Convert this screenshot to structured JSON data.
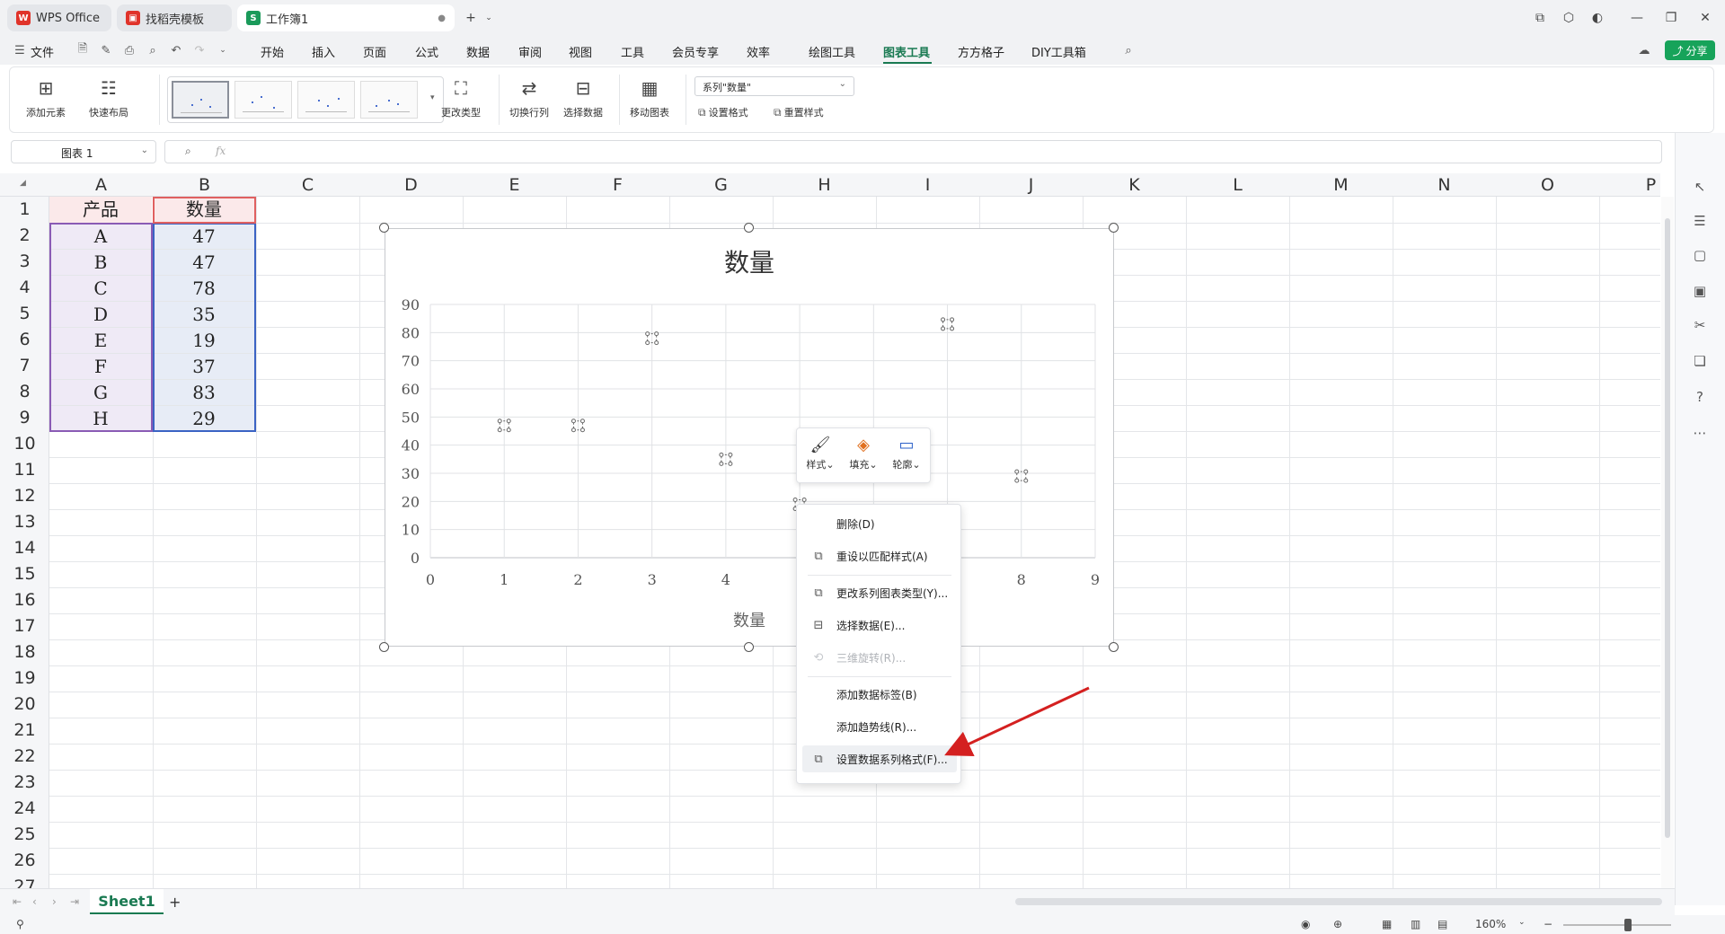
{
  "tabs": [
    {
      "label": "WPS Office",
      "icon": "wps-logo-icon"
    },
    {
      "label": "找稻壳模板",
      "icon": "docer-icon"
    },
    {
      "label": "工作簿1",
      "icon": "spreadsheet-s-icon"
    }
  ],
  "menu": {
    "file": "文件",
    "items": [
      "开始",
      "插入",
      "页面",
      "公式",
      "数据",
      "审阅",
      "视图",
      "工具",
      "会员专享",
      "效率",
      "绘图工具",
      "图表工具",
      "方方格子",
      "DIY工具箱"
    ],
    "active": "图表工具",
    "share": "分享"
  },
  "ribbon": {
    "add_element": "添加元素",
    "quick_layout": "快速布局",
    "change_type": "更改类型",
    "switch_row_col": "切换行列",
    "select_data": "选择数据",
    "move_chart": "移动图表",
    "series_select": "系列\"数量\"",
    "set_format": "设置格式",
    "reset_style": "重置样式"
  },
  "formula_bar": {
    "name_box": "图表 1",
    "fx": "fx"
  },
  "sheet": {
    "columns": [
      "A",
      "B",
      "C",
      "D",
      "E",
      "F",
      "G",
      "H",
      "I",
      "J",
      "K",
      "L",
      "M",
      "N",
      "O",
      "P"
    ],
    "rows": [
      "1",
      "2",
      "3",
      "4",
      "5",
      "6",
      "7",
      "8",
      "9",
      "10",
      "11",
      "12",
      "13",
      "14",
      "15",
      "16",
      "17",
      "18",
      "19",
      "20",
      "21",
      "22",
      "23",
      "24",
      "25",
      "26",
      "27"
    ],
    "header": [
      "产品",
      "数量"
    ],
    "data": [
      [
        "A",
        "47"
      ],
      [
        "B",
        "47"
      ],
      [
        "C",
        "78"
      ],
      [
        "D",
        "35"
      ],
      [
        "E",
        "19"
      ],
      [
        "F",
        "37"
      ],
      [
        "G",
        "83"
      ],
      [
        "H",
        "29"
      ]
    ]
  },
  "chart_data": {
    "type": "scatter",
    "title": "数量",
    "xlabel": "数量",
    "ylabel": "",
    "x": [
      1,
      2,
      3,
      4,
      5,
      6,
      7,
      8
    ],
    "values": [
      47,
      47,
      78,
      35,
      19,
      37,
      83,
      29
    ],
    "xlim": [
      0,
      9
    ],
    "ylim": [
      0,
      90
    ],
    "xticks": [
      "0",
      "1",
      "2",
      "3",
      "4",
      "5",
      "6",
      "7",
      "8",
      "9"
    ],
    "yticks": [
      "0",
      "10",
      "20",
      "30",
      "40",
      "50",
      "60",
      "70",
      "80",
      "90"
    ],
    "grid": true,
    "legend": "none"
  },
  "mini_toolbar": {
    "style": "样式",
    "fill": "填充",
    "outline": "轮廓"
  },
  "context_menu": {
    "delete": "删除(D)",
    "reset_style": "重设以匹配样式(A)",
    "change_series_type": "更改系列图表类型(Y)...",
    "select_data": "选择数据(E)...",
    "rotate_3d": "三维旋转(R)...",
    "add_labels": "添加数据标签(B)",
    "add_trendline": "添加趋势线(R)...",
    "format_series": "设置数据系列格式(F)..."
  },
  "sheet_tabs": {
    "active": "Sheet1",
    "add": "+"
  },
  "status": {
    "zoom": "160%"
  },
  "colors": {
    "accent": "#1a7a52",
    "share_bg": "#17a35a",
    "arrow": "#d42020"
  }
}
